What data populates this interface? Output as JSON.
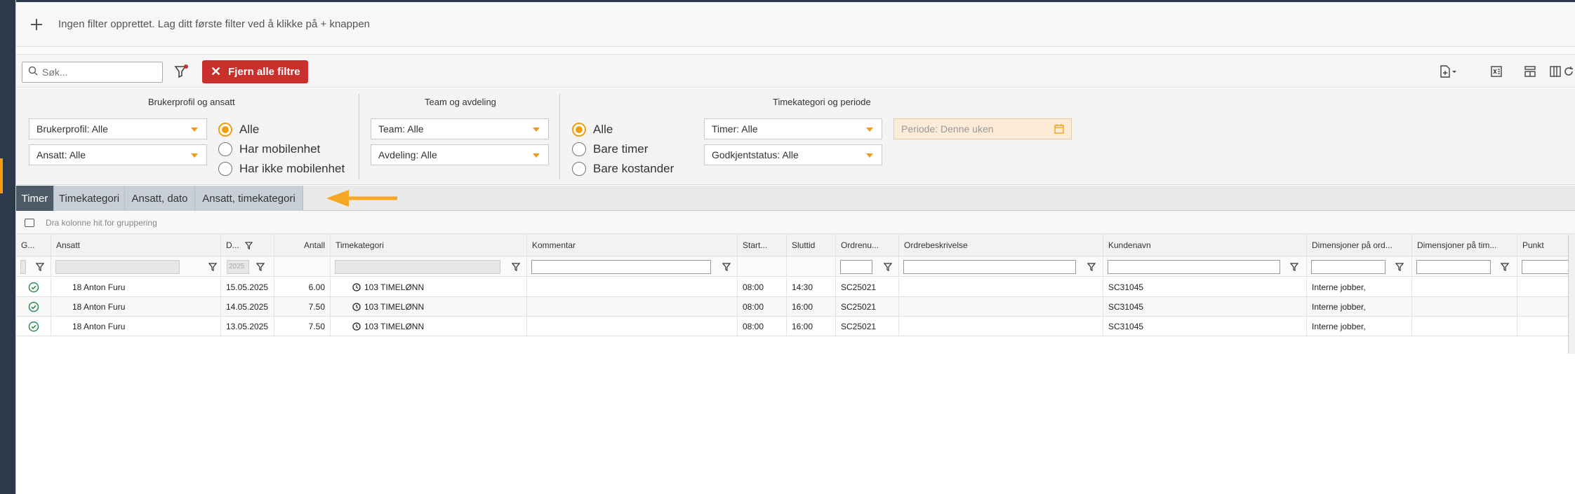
{
  "filter_bar": {
    "plus_icon": "plus-icon",
    "message": "Ingen filter opprettet. Lag ditt første filter ved å klikke på + knappen"
  },
  "toolbar": {
    "search_placeholder": "Søk...",
    "clear_filters_label": "Fjern alle filtre",
    "colors": {
      "danger": "#c9302c",
      "accent": "#f39c12"
    },
    "right_icons": [
      "new-document-icon",
      "excel-export-icon",
      "layout-icon",
      "columns-icon",
      "refresh-icon"
    ]
  },
  "filter_panel": {
    "group1": {
      "title": "Brukerprofil og ansatt",
      "dropdowns": [
        "Brukerprofil: Alle",
        "Ansatt: Alle"
      ],
      "radios": [
        {
          "label": "Alle",
          "selected": true
        },
        {
          "label": "Har mobilenhet",
          "selected": false
        },
        {
          "label": "Har ikke mobilenhet",
          "selected": false
        }
      ]
    },
    "group2": {
      "title": "Team og avdeling",
      "dropdowns": [
        "Team: Alle",
        "Avdeling: Alle"
      ]
    },
    "group3": {
      "title": "Timekategori og periode",
      "radios": [
        {
          "label": "Alle",
          "selected": true
        },
        {
          "label": "Bare timer",
          "selected": false
        },
        {
          "label": "Bare kostander",
          "selected": false
        }
      ],
      "dropdowns": [
        "Timer: Alle",
        "Godkjentstatus: Alle"
      ],
      "period_placeholder": "Periode: Denne uken"
    }
  },
  "tabs": [
    {
      "label": "Timer",
      "active": true
    },
    {
      "label": "Timekategori",
      "active": false
    },
    {
      "label": "Ansatt, dato",
      "active": false
    },
    {
      "label": "Ansatt, timekategori",
      "active": false
    }
  ],
  "group_hint": "Dra kolonne hit for gruppering",
  "grid": {
    "columns": [
      "G...",
      "Ansatt",
      "D...",
      "Antall",
      "Timekategori",
      "Kommentar",
      "Start...",
      "Sluttid",
      "Ordrenu...",
      "Ordrebeskrivelse",
      "Kundenavn",
      "Dimensjoner på ord...",
      "Dimensjoner på tim...",
      "Punkt"
    ],
    "date_filter_value": "2025",
    "rows": [
      {
        "ansatt": "18 Anton Furu",
        "dato": "15.05.2025",
        "antall": "6.00",
        "timekategori": "103 TIMELØNN",
        "kommentar": "",
        "start": "08:00",
        "slutt": "14:30",
        "ordrenr": "SC25021",
        "ordrebeskrivelse": "",
        "kundenavn": "SC31045",
        "dim_ordre": "Interne jobber,",
        "dim_time": "",
        "punkt": ""
      },
      {
        "ansatt": "18 Anton Furu",
        "dato": "14.05.2025",
        "antall": "7.50",
        "timekategori": "103 TIMELØNN",
        "kommentar": "",
        "start": "08:00",
        "slutt": "16:00",
        "ordrenr": "SC25021",
        "ordrebeskrivelse": "",
        "kundenavn": "SC31045",
        "dim_ordre": "Interne jobber,",
        "dim_time": "",
        "punkt": ""
      },
      {
        "ansatt": "18 Anton Furu",
        "dato": "13.05.2025",
        "antall": "7.50",
        "timekategori": "103 TIMELØNN",
        "kommentar": "",
        "start": "08:00",
        "slutt": "16:00",
        "ordrenr": "SC25021",
        "ordrebeskrivelse": "",
        "kundenavn": "SC31045",
        "dim_ordre": "Interne jobber,",
        "dim_time": "",
        "punkt": ""
      }
    ]
  }
}
